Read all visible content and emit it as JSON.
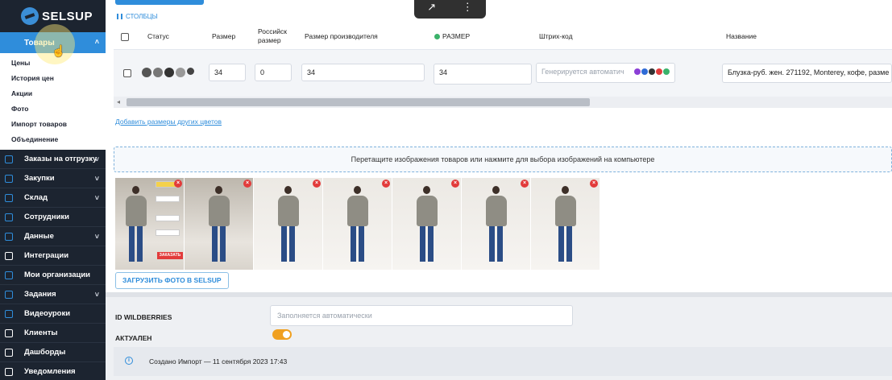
{
  "sidebar": {
    "logo_text": "SELSUP",
    "active_item": "Товары",
    "submenu": [
      "Цены",
      "История цен",
      "Акции",
      "Фото",
      "Импорт товаров",
      "Объединение"
    ],
    "items": [
      {
        "label": "Заказы на отгрузку",
        "icon": "box-icon",
        "has_chevron": true
      },
      {
        "label": "Закупки",
        "icon": "cart-icon",
        "has_chevron": true
      },
      {
        "label": "Склад",
        "icon": "warehouse-icon",
        "has_chevron": true
      },
      {
        "label": "Сотрудники",
        "icon": "person-icon",
        "has_chevron": false
      },
      {
        "label": "Данные",
        "icon": "data-icon",
        "has_chevron": true
      },
      {
        "label": "Интеграции",
        "icon": "gear-icon",
        "has_chevron": false
      },
      {
        "label": "Мои организации",
        "icon": "building-icon",
        "has_chevron": false
      },
      {
        "label": "Задания",
        "icon": "tasks-icon",
        "has_chevron": true
      },
      {
        "label": "Видеоуроки",
        "icon": "video-icon",
        "has_chevron": false
      },
      {
        "label": "Клиенты",
        "icon": "lock-icon",
        "has_chevron": false
      },
      {
        "label": "Дашборды",
        "icon": "grid-icon",
        "has_chevron": false
      },
      {
        "label": "Уведомления",
        "icon": "bell-icon",
        "has_chevron": false
      }
    ]
  },
  "toolbar": {
    "columns_label": "СТОЛБЦЫ"
  },
  "table": {
    "headers": {
      "status": "Статус",
      "size": "Размер",
      "russian_size_1": "Российск",
      "russian_size_2": "размер",
      "manufacturer_size": "Размер производителя",
      "wb_size": "РАЗМЕР",
      "barcode": "Штрих-код",
      "name": "Название"
    },
    "row": {
      "size": "34",
      "russian_size": "0",
      "manufacturer_size": "34",
      "wb_size": "34",
      "barcode_placeholder": "Генерируется автоматич",
      "name": "Блузка-руб. жен. 271192, Monterey, кофе, разме"
    }
  },
  "links": {
    "add_sizes": "Добавить размеры других цветов"
  },
  "dropzone": {
    "text": "Перетащите изображения товаров или нажмите для выбора изображений на компьютере"
  },
  "photos": {
    "count": 7,
    "first_photo_button": "ЗАКАЗАТЬ",
    "delete_symbol": "×"
  },
  "upload_button": "ЗАГРУЗИТЬ ФОТО В SELSUP",
  "fields": {
    "id_label": "ID WILDBERRIES",
    "id_placeholder": "Заполняется автоматически",
    "actual_label": "АКТУАЛЕН",
    "actual_value": true
  },
  "info": {
    "text": "Создано Импорт — 11 сентября 2023 17:43"
  },
  "colors": {
    "accent": "#2f8ddb",
    "sidebar_bg": "#1c2430",
    "toggle_on": "#f0a020",
    "delete": "#e23b3b"
  }
}
